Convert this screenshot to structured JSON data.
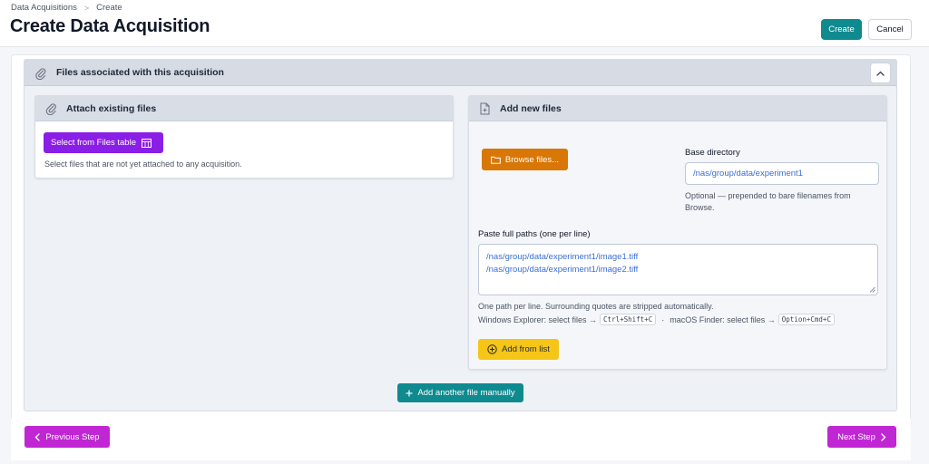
{
  "header": {
    "breadcrumb": [
      "Data Acquisitions",
      "Create"
    ],
    "title": "Create Data Acquisition",
    "create_label": "Create",
    "cancel_label": "Cancel"
  },
  "section": {
    "title": "Files associated with this acquisition",
    "left_panel": {
      "title": "Attach existing files",
      "select_button": "Select from Files table",
      "help": "Select files that are not yet attached to any acquisition."
    },
    "right_panel": {
      "title": "Add new files",
      "browse_button": "Browse files...",
      "base_directory_label": "Base directory",
      "base_directory_value": "/nas/group/data/experiment1",
      "base_directory_help": "Optional — prepended to bare filenames from Browse.",
      "paste_label": "Paste full paths (one per line)",
      "paste_lines": [
        "/nas/group/data/experiment1/image1.tiff",
        "/nas/group/data/experiment1/image2.tiff"
      ],
      "help_line1": "One path per line. Surrounding quotes are stripped automatically.",
      "help_windows": "Windows Explorer: select files →",
      "windows_shortcut": "Ctrl+Shift+C",
      "help_dot": "·",
      "help_mac": "macOS Finder: select files →",
      "mac_shortcut": "Option+Cmd+C",
      "add_from_list": "Add from list"
    },
    "add_manual_button": "Add another file manually"
  },
  "footer": {
    "previous_label": "Previous Step",
    "next_label": "Next Step"
  },
  "colors": {
    "teal": "#0f8a8f",
    "purple": "#8b1ee6",
    "magenta": "#c026d3",
    "orange": "#d97706",
    "yellow": "#f5c518",
    "link_blue": "#3b6fd6"
  }
}
